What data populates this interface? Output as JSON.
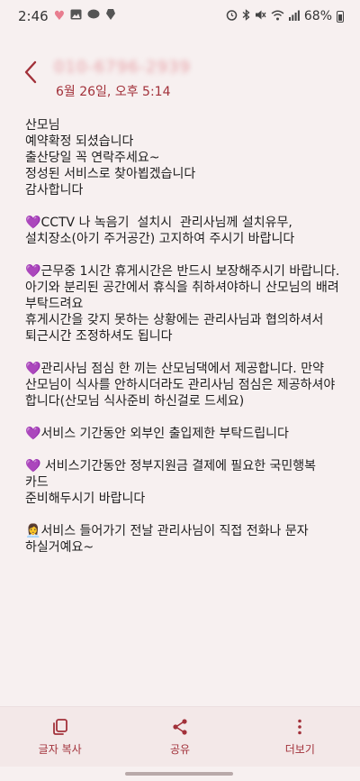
{
  "status_bar": {
    "time": "2:46",
    "battery": "68%",
    "left_icons": [
      "heart-icon",
      "image-icon",
      "chat-icon",
      "app-icon"
    ],
    "right_icons": [
      "alarm-icon",
      "bluetooth-icon",
      "mute-icon",
      "wifi-icon",
      "signal-icon",
      "battery-icon"
    ]
  },
  "header": {
    "sender": "010-6796-2939",
    "timestamp": "6월 26일, 오후 5:14"
  },
  "message": {
    "greeting": "산모님\n예약확정 되셨습니다\n출산당일 꼭 연락주세요~\n정성된 서비스로 찾아뵙겠습니다\n감사합니다",
    "cctv": "CCTV 나 녹음기  설치시  관리사님께 설치유무, 설치장소(아기 주거공간) 고지하여 주시기 바랍니다",
    "break_time": "근무중 1시간 휴게시간은 반드시 보장해주시기 바랍니다.\n아기와 분리된 공간에서 휴식을 취하셔야하니 산모님의 배려 부탁드려요\n휴게시간을 갖지 못하는 상황에는 관리사님과 협의하셔서 퇴근시간 조정하셔도 됩니다",
    "lunch": "관리사님 점심 한 끼는 산모님댁에서 제공합니다. 만약 산모님이 식사를 안하시더라도 관리사님 점심은 제공하셔야 합니다(산모님 식사준비 하신걸로 드세요)",
    "visitors": "서비스 기간동안 외부인 출입제한 부탁드립니다",
    "card": " 서비스기간동안 정부지원금 결제에 필요한 국민행복 카드\n준비해두시기 바랍니다",
    "contact": "서비스 들어가기 전날 관리사님이 직접 전화나 문자 하실거예요~",
    "heart_emoji": "💜",
    "person_emoji": "👩‍💼"
  },
  "bottom_bar": {
    "copy_label": "글자 복사",
    "share_label": "공유",
    "more_label": "더보기"
  },
  "colors": {
    "accent": "#a2313a",
    "background": "#f7f0f0",
    "bottom_bar": "#f3e8e8"
  }
}
